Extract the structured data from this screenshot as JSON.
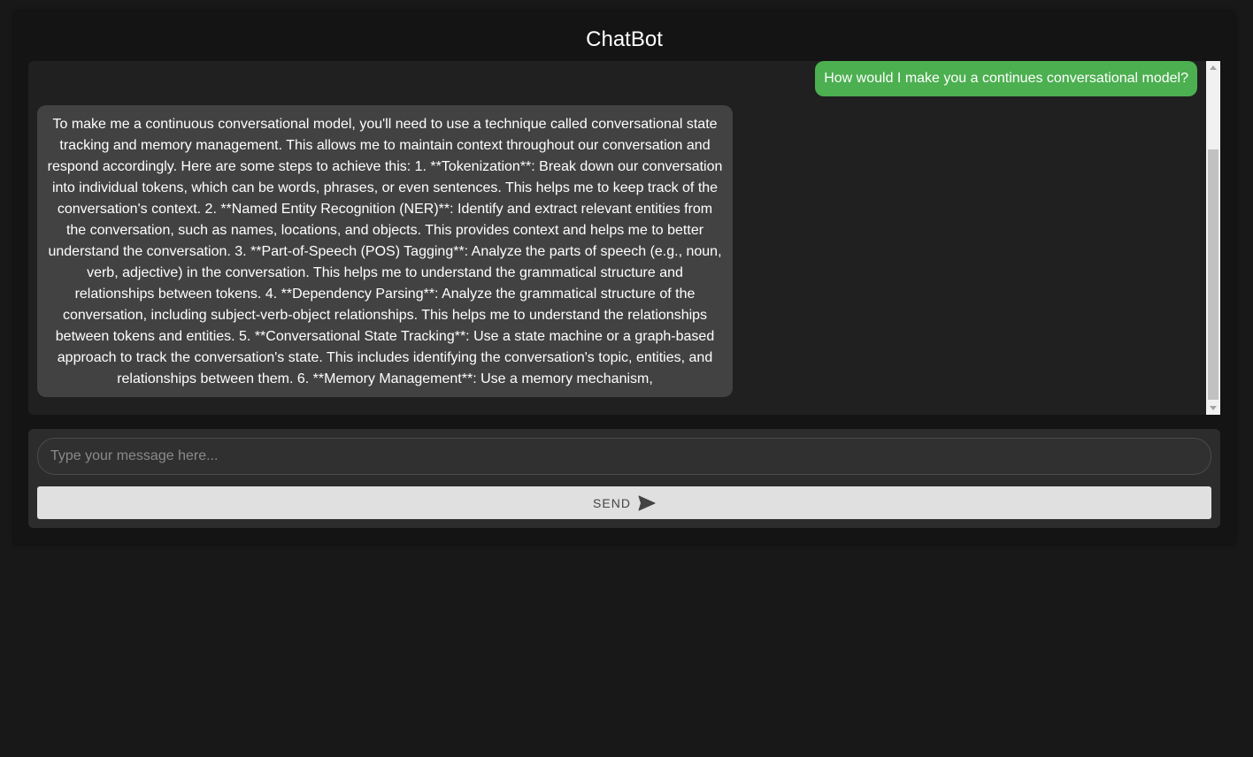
{
  "header": {
    "title": "ChatBot"
  },
  "messages": [
    {
      "role": "user",
      "text": "How would I make you a continues conversational model?"
    },
    {
      "role": "bot",
      "text": "To make me a continuous conversational model, you'll need to use a technique called conversational state tracking and memory management. This allows me to maintain context throughout our conversation and respond accordingly. Here are some steps to achieve this: 1. **Tokenization**: Break down our conversation into individual tokens, which can be words, phrases, or even sentences. This helps me to keep track of the conversation's context. 2. **Named Entity Recognition (NER)**: Identify and extract relevant entities from the conversation, such as names, locations, and objects. This provides context and helps me to better understand the conversation. 3. **Part-of-Speech (POS) Tagging**: Analyze the parts of speech (e.g., noun, verb, adjective) in the conversation. This helps me to understand the grammatical structure and relationships between tokens. 4. **Dependency Parsing**: Analyze the grammatical structure of the conversation, including subject-verb-object relationships. This helps me to understand the relationships between tokens and entities. 5. **Conversational State Tracking**: Use a state machine or a graph-based approach to track the conversation's state. This includes identifying the conversation's topic, entities, and relationships between them. 6. **Memory Management**: Use a memory mechanism,"
    }
  ],
  "input": {
    "placeholder": "Type your message here...",
    "value": ""
  },
  "send_button": {
    "label": "SEND",
    "icon": "send-icon"
  },
  "colors": {
    "page_background": "#181818",
    "user_bubble": "#4caf50",
    "bot_bubble": "#424242",
    "send_button": "#e0e0e0"
  }
}
